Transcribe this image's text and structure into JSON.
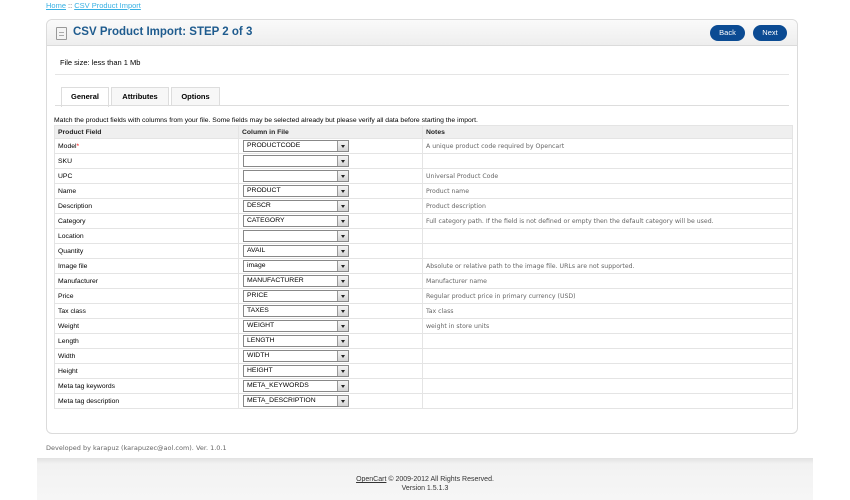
{
  "breadcrumb": {
    "home": "Home",
    "separator": "::",
    "current": "CSV Product Import"
  },
  "header": {
    "title": "CSV Product Import: STEP 2 of 3",
    "back_label": "Back",
    "next_label": "Next"
  },
  "file_size_text": "File size: less than 1 Mb",
  "tabs": [
    "General",
    "Attributes",
    "Options"
  ],
  "active_tab": "General",
  "instructions": "Match the product fields with columns from your file. Some fields may be selected already but please verify all data before starting the import.",
  "table": {
    "headers": [
      "Product Field",
      "Column in File",
      "Notes"
    ],
    "rows": [
      {
        "field": "Model",
        "required": "*",
        "column": "PRODUCTCODE",
        "note": "A unique product code required by Opencart"
      },
      {
        "field": "SKU",
        "required": "",
        "column": "",
        "note": ""
      },
      {
        "field": "UPC",
        "required": "",
        "column": "",
        "note": "Universal Product Code"
      },
      {
        "field": "Name",
        "required": "",
        "column": "PRODUCT",
        "note": "Product name"
      },
      {
        "field": "Description",
        "required": "",
        "column": "DESCR",
        "note": "Product description"
      },
      {
        "field": "Category",
        "required": "",
        "column": "CATEGORY",
        "note": "Full category path. If the field is not defined or empty then the default category will be used."
      },
      {
        "field": "Location",
        "required": "",
        "column": "",
        "note": ""
      },
      {
        "field": "Quantity",
        "required": "",
        "column": "AVAIL",
        "note": ""
      },
      {
        "field": "Image file",
        "required": "",
        "column": "image",
        "note": "Absolute or relative path to the image file. URLs are not supported."
      },
      {
        "field": "Manufacturer",
        "required": "",
        "column": "MANUFACTURER",
        "note": "Manufacturer name"
      },
      {
        "field": "Price",
        "required": "",
        "column": "PRICE",
        "note": "Regular product price in primary currency (USD)"
      },
      {
        "field": "Tax class",
        "required": "",
        "column": "TAXES",
        "note": "Tax class"
      },
      {
        "field": "Weight",
        "required": "",
        "column": "WEIGHT",
        "note": "weight in store units"
      },
      {
        "field": "Length",
        "required": "",
        "column": "LENGTH",
        "note": ""
      },
      {
        "field": "Width",
        "required": "",
        "column": "WIDTH",
        "note": ""
      },
      {
        "field": "Height",
        "required": "",
        "column": "HEIGHT",
        "note": ""
      },
      {
        "field": "Meta tag keywords",
        "required": "",
        "column": "META_KEYWORDS",
        "note": ""
      },
      {
        "field": "Meta tag description",
        "required": "",
        "column": "META_DESCRIPTION",
        "note": ""
      }
    ]
  },
  "developed_by": "Developed by karapuz (karapuzec@aol.com). Ver. 1.0.1",
  "footer": {
    "link": "OpenCart",
    "copyright": " © 2009-2012 All Rights Reserved.",
    "version": "Version 1.5.1.3"
  },
  "colors": {
    "button_bg": "#0b4b93",
    "title": "#1e5b8e",
    "link": "#38b0e3",
    "required_star": "#ff0000"
  }
}
